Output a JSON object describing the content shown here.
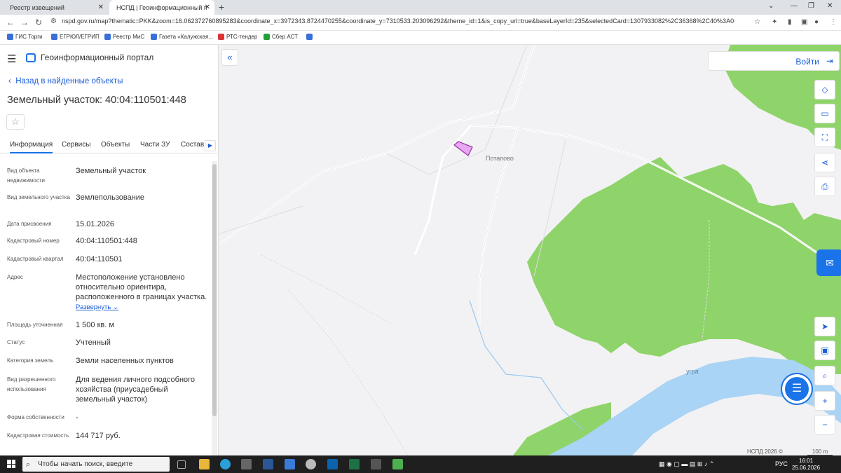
{
  "browser": {
    "tabs": [
      {
        "title": "Реестр извещений",
        "close": "✕"
      },
      {
        "title": "НСПД | Геоинформационный п",
        "close": "✕"
      }
    ],
    "new_tab": "+",
    "url": "nspd.gov.ru/map?thematic=PKK&zoom=16.062372760895283&coordinate_x=3972343.8724470255&coordinate_y=7310533.203096292&theme_id=1&is_copy_url=true&baseLayerId=235&selectedCard=1307933082%2C36368%2C40%3A04%3A11...",
    "bookmarks": [
      "ГИС Торги",
      "ЕГРЮЛ/ЕГРИП",
      "Реестр МиС",
      "Газета «Калужская...",
      "РТС-тендер",
      "Сбер АСТ"
    ]
  },
  "sidebar": {
    "portal_title": "Геоинформационный портал",
    "back_link": "Назад в найденные объекты",
    "title": "Земельный участок: 40:04:110501:448",
    "tabs": [
      "Информация",
      "Сервисы",
      "Объекты",
      "Части ЗУ",
      "Состав"
    ],
    "properties": [
      {
        "label": "Вид объекта недвижимости",
        "value": "Земельный участок"
      },
      {
        "label": "Вид земельного участка",
        "value": "Землепользование"
      },
      {
        "label": "Дата присвоения",
        "value": "15.01.2026"
      },
      {
        "label": "Кадастровый номер",
        "value": "40:04:110501:448"
      },
      {
        "label": "Кадастровый квартал",
        "value": "40:04:110501"
      },
      {
        "label": "Адрес",
        "value": "Местоположение установлено относительно ориентира, расположенного в границах участка."
      },
      {
        "label": "Площадь уточненная",
        "value": "1 500 кв. м"
      },
      {
        "label": "Статус",
        "value": "Учтенный"
      },
      {
        "label": "Категория земель",
        "value": "Земли населенных пунктов"
      },
      {
        "label": "Вид разрешенного использования",
        "value": "Для ведения личного подсобного хозяйства (приусадебный земельный участок)"
      },
      {
        "label": "Форма собственности",
        "value": "-"
      },
      {
        "label": "Кадастровая стоимость",
        "value": "144 717 руб."
      }
    ],
    "expand_label": "Развернуть"
  },
  "map": {
    "login": "Войти",
    "place_village": "Потапово",
    "place_river": "угра",
    "attribution": "НСПД 2026 ©",
    "scale": "100 m"
  },
  "taskbar": {
    "search_placeholder": "Чтобы начать поиск, введите",
    "lang": "РУС",
    "time": "16:01",
    "date": "25.06.2026"
  },
  "colors": {
    "accent": "#1a73e8",
    "forest": "#8fd46a",
    "water": "#a9d4f5",
    "parcel": "#e6a9f0"
  }
}
